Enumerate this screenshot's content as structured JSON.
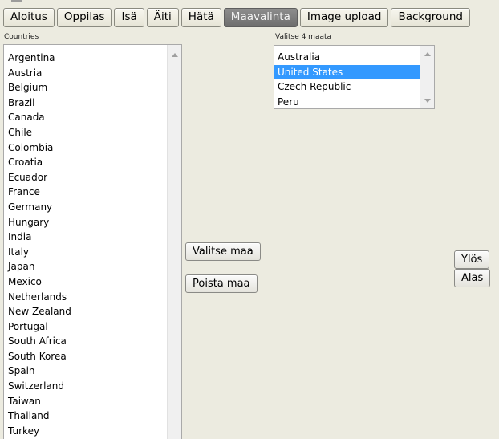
{
  "tabs": [
    {
      "label": "Aloitus",
      "active": false
    },
    {
      "label": "Oppilas",
      "active": false
    },
    {
      "label": "Isä",
      "active": false
    },
    {
      "label": "Äiti",
      "active": false
    },
    {
      "label": "Hätä",
      "active": false
    },
    {
      "label": "Maavalinta",
      "active": true
    },
    {
      "label": "Image upload",
      "active": false
    },
    {
      "label": "Background",
      "active": false
    }
  ],
  "countries": {
    "label": "Countries",
    "items": [
      "Argentina",
      "Austria",
      "Belgium",
      "Brazil",
      "Canada",
      "Chile",
      "Colombia",
      "Croatia",
      "Ecuador",
      "France",
      "Germany",
      "Hungary",
      "India",
      "Italy",
      "Japan",
      "Mexico",
      "Netherlands",
      "New Zealand",
      "Portugal",
      "South Africa",
      "South Korea",
      "Spain",
      "Switzerland",
      "Taiwan",
      "Thailand",
      "Turkey"
    ]
  },
  "selected": {
    "label": "Valitse 4 maata",
    "items": [
      "Australia",
      "United States",
      "Czech Republic",
      "Peru"
    ],
    "highlighted_index": 1
  },
  "buttons": {
    "choose": "Valitse maa",
    "remove": "Poista maa",
    "up": "Ylös",
    "down": "Alas"
  },
  "colors": {
    "background": "#ecebe0",
    "highlight": "#3399ff",
    "active_tab": "#7d7d7d"
  }
}
